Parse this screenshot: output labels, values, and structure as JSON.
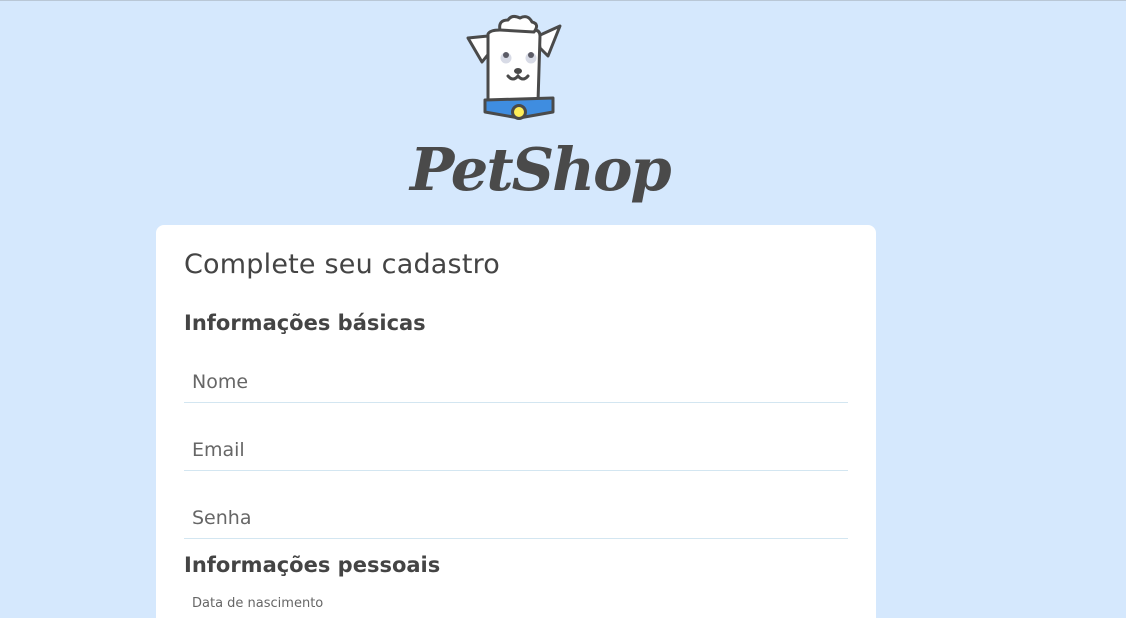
{
  "brand": {
    "name": "PetShop",
    "logo_icon": "dog-mascot-icon",
    "colors": {
      "background": "#d5e8fd",
      "card": "#ffffff",
      "collar": "#3f8de0",
      "tag": "#ffee58",
      "text": "#464646"
    }
  },
  "form": {
    "title": "Complete seu cadastro",
    "basic_section": {
      "title": "Informações básicas",
      "name_placeholder": "Nome",
      "email_placeholder": "Email",
      "password_placeholder": "Senha"
    },
    "personal_section": {
      "title": "Informações pessoais",
      "birthdate_label": "Data de nascimento"
    }
  }
}
